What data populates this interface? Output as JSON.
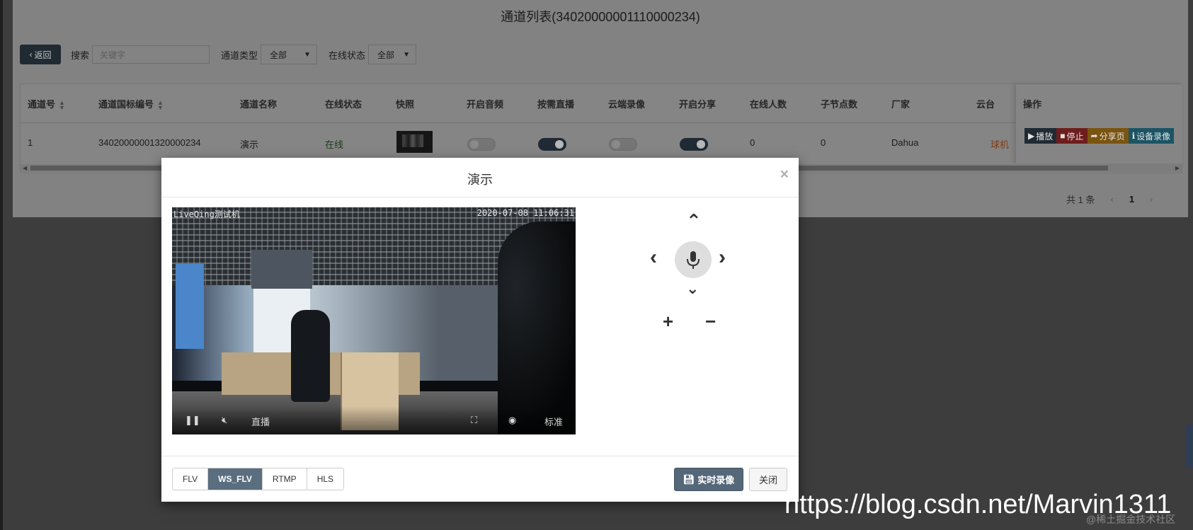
{
  "page": {
    "title": "通道列表(34020000001110000234)"
  },
  "toolbar": {
    "back_label": "返回",
    "search_label": "搜索",
    "search_placeholder": "关键字",
    "channel_type_label": "通道类型",
    "channel_type_value": "全部",
    "online_status_label": "在线状态",
    "online_status_value": "全部"
  },
  "table": {
    "columns": [
      "通道号",
      "通道国标编号",
      "通道名称",
      "在线状态",
      "快照",
      "开启音频",
      "按需直播",
      "云端录像",
      "开启分享",
      "在线人数",
      "子节点数",
      "厂家",
      "云台",
      "操作"
    ],
    "row": {
      "channel_no": "1",
      "gb_id": "34020000001320000234",
      "name": "演示",
      "status": "在线",
      "audio_on": false,
      "on_demand": true,
      "cloud_record": false,
      "share_on": true,
      "online_count": "0",
      "child_count": "0",
      "vendor": "Dahua",
      "ptz": "球机"
    },
    "ops": {
      "play": "播放",
      "stop": "停止",
      "share": "分享页",
      "record": "设备录像"
    }
  },
  "pager": {
    "total": "共 1 条",
    "current": "1"
  },
  "modal": {
    "title": "演示",
    "close_glyph": "×",
    "video": {
      "osd_left": "LiveQing测试机",
      "osd_right": "2020-07-08 11:06:31",
      "live_label": "直播",
      "quality_label": "标准"
    },
    "formats": [
      "FLV",
      "WS_FLV",
      "RTMP",
      "HLS"
    ],
    "active_format": "WS_FLV",
    "record_btn": "实时录像",
    "close_btn": "关闭"
  },
  "watermark": {
    "url": "https://blog.csdn.net/Marvin1311",
    "community": "@稀土掘金技术社区"
  }
}
